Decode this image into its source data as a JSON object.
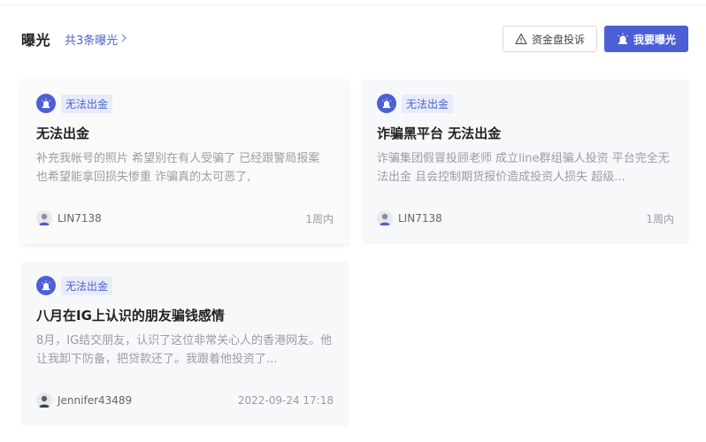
{
  "header": {
    "title": "曝光",
    "count_link": "共3条曝光",
    "complaint_button": "资金盘投诉",
    "expose_button": "我要曝光"
  },
  "cards": [
    {
      "tag": "无法出金",
      "title": "无法出金",
      "desc": "补充我帐号的照片 希望别在有人受骗了 已经跟警局报案 也希望能拿回损失惨重 诈骗真的太可恶了,",
      "user": "LIN7138",
      "time": "1周内"
    },
    {
      "tag": "无法出金",
      "title": "诈骗黑平台 无法出金",
      "desc": "诈骗集团假冒投顾老师 成立line群组骗人投资 平台完全无法出金 且会控制期货报价造成投资人损失 超级...",
      "user": "LIN7138",
      "time": "1周内"
    },
    {
      "tag": "无法出金",
      "title": "八月在IG上认识的朋友骗钱感情",
      "desc": "8月，IG结交朋友，认识了这位非常关心人的香港网友。他让我卸下防备，把贷款还了。我跟着他投资了...",
      "user": "Jennifer43489",
      "time": "2022-09-24 17:18"
    }
  ],
  "colors": {
    "accent": "#4c5fd5",
    "tag_bg": "#e8ebfa",
    "card_bg": "#f7f8fa"
  },
  "icons": {
    "complaint": "warning-triangle-icon",
    "expose": "alarm-light-icon",
    "tag": "alarm-light-icon",
    "avatar": "user-avatar-icon"
  }
}
